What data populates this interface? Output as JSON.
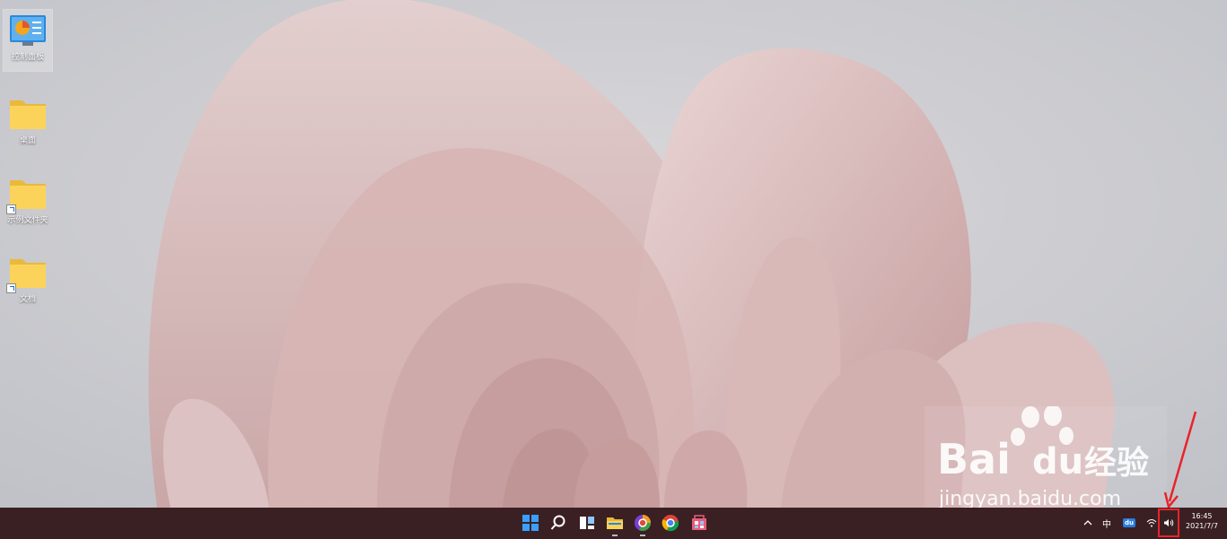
{
  "desktop": {
    "icons": [
      {
        "label": "控制面板",
        "icon": "control-panel-icon"
      },
      {
        "label": "桌面",
        "icon": "folder-icon"
      },
      {
        "label": "示例文件夹",
        "icon": "folder-shortcut-icon"
      },
      {
        "label": "文档",
        "icon": "folder-shortcut-icon"
      }
    ]
  },
  "watermark": {
    "brand": "Bai",
    "brand_du": "du",
    "brand_cn": "经验",
    "url": "jingyan.baidu.com"
  },
  "taskbar": {
    "apps": [
      "start-icon",
      "search-icon",
      "task-view-icon",
      "file-explorer-icon",
      "browser-icon",
      "chrome-icon",
      "store-icon"
    ],
    "tray": {
      "ime": "中",
      "baidu_badge": "du",
      "chevron": "^"
    },
    "clock": {
      "time": "16:45",
      "date": "2021/7/7"
    }
  },
  "colors": {
    "taskbar": "#3b2023",
    "annotation": "#e8242a",
    "accent": "#1f7fd8"
  }
}
